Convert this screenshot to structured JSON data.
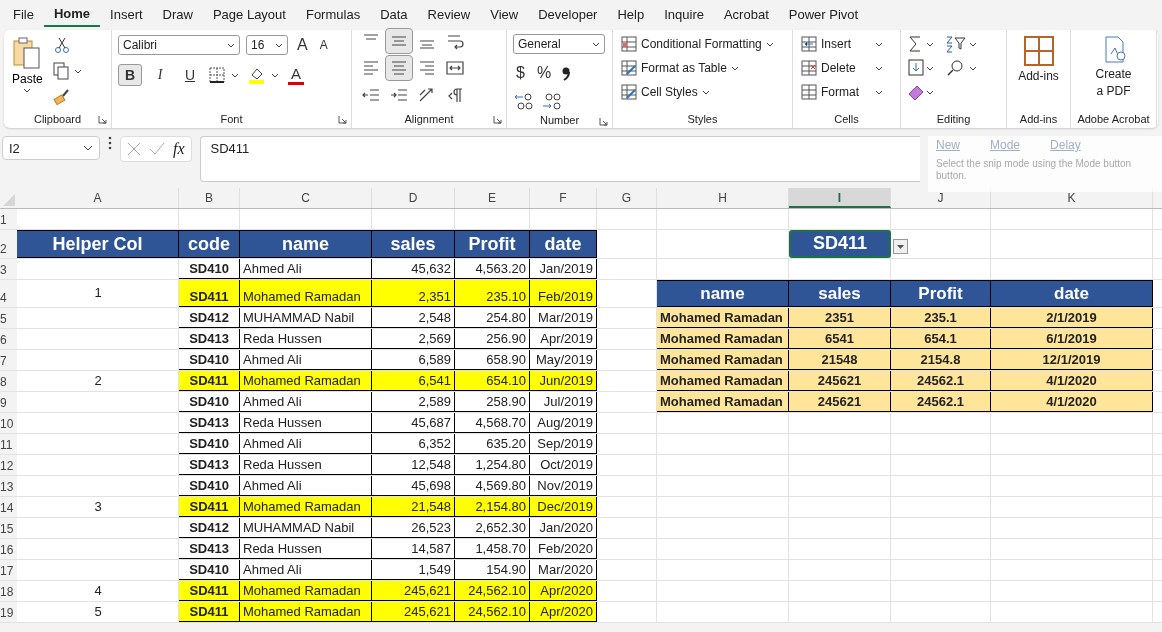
{
  "menu_tabs": [
    {
      "label": "File",
      "selected": false
    },
    {
      "label": "Home",
      "selected": true
    },
    {
      "label": "Insert",
      "selected": false
    },
    {
      "label": "Draw",
      "selected": false
    },
    {
      "label": "Page Layout",
      "selected": false
    },
    {
      "label": "Formulas",
      "selected": false
    },
    {
      "label": "Data",
      "selected": false
    },
    {
      "label": "Review",
      "selected": false
    },
    {
      "label": "View",
      "selected": false
    },
    {
      "label": "Developer",
      "selected": false
    },
    {
      "label": "Help",
      "selected": false
    },
    {
      "label": "Inquire",
      "selected": false
    },
    {
      "label": "Acrobat",
      "selected": false
    },
    {
      "label": "Power Pivot",
      "selected": false
    }
  ],
  "ribbon": {
    "clipboard": {
      "paste": "Paste",
      "label": "Clipboard"
    },
    "font": {
      "name": "Calibri",
      "size": "16",
      "grow": "A",
      "shrink": "A",
      "bold": {
        "label": "B",
        "selected": true
      },
      "italic": {
        "label": "I",
        "selected": false
      },
      "underline": {
        "label": "U",
        "selected": false
      },
      "font_color": "A",
      "label": "Font"
    },
    "alignment": {
      "rows": [
        [
          {
            "kind": "top",
            "selected": false
          },
          {
            "kind": "middle",
            "selected": true
          },
          {
            "kind": "bottom",
            "selected": false
          },
          {
            "kind": "wrap",
            "selected": false
          }
        ],
        [
          {
            "kind": "left",
            "selected": false
          },
          {
            "kind": "center",
            "selected": true
          },
          {
            "kind": "right",
            "selected": false
          },
          {
            "kind": "merge",
            "selected": false
          }
        ],
        [
          {
            "kind": "outdent",
            "selected": false
          },
          {
            "kind": "indent",
            "selected": false
          },
          {
            "kind": "orientation",
            "selected": false
          },
          {
            "kind": "rtl",
            "selected": false
          }
        ]
      ],
      "label": "Alignment"
    },
    "number": {
      "format": "General",
      "currency": "$",
      "percent": "%",
      "label": "Number"
    },
    "styles": {
      "items": [
        "Conditional Formatting",
        "Format as Table",
        "Cell Styles"
      ],
      "label": "Styles"
    },
    "cells": {
      "items": [
        "Insert",
        "Delete",
        "Format"
      ],
      "label": "Cells"
    },
    "editing": {
      "label": "Editing"
    },
    "addins": {
      "button": "Add-ins",
      "label": "Add-ins"
    },
    "acrobat": {
      "button_lines": [
        "Create",
        "a PDF"
      ],
      "label": "Adobe Acrobat"
    }
  },
  "formula_bar": {
    "name_box": "I2",
    "fx": "fx",
    "value": "SD411"
  },
  "snip_tool": {
    "buttons": [
      "New",
      "Mode",
      "Delay"
    ],
    "hint_lines": [
      "Select the snip mode using the Mode button",
      "button."
    ]
  },
  "sheet": {
    "column_letters": [
      {
        "label": "A",
        "selected": false
      },
      {
        "label": "B",
        "selected": false
      },
      {
        "label": "C",
        "selected": false
      },
      {
        "label": "D",
        "selected": false
      },
      {
        "label": "E",
        "selected": false
      },
      {
        "label": "F",
        "selected": false
      },
      {
        "label": "G",
        "selected": false
      },
      {
        "label": "H",
        "selected": false
      },
      {
        "label": "I",
        "selected": true
      },
      {
        "label": "J",
        "selected": false
      },
      {
        "label": "K",
        "selected": false
      }
    ],
    "row_numbers": [
      "1",
      "2",
      "3",
      "4",
      "5",
      "6",
      "7",
      "8",
      "9",
      "10",
      "11",
      "12",
      "13",
      "14",
      "15",
      "16",
      "17",
      "18",
      "19"
    ]
  },
  "main_table": {
    "columns": [
      "Helper Col",
      "code",
      "name",
      "sales",
      "Profit",
      "date"
    ],
    "rows": [
      {
        "code": "SD410",
        "name": "Ahmed Ali",
        "sales": "45,632",
        "profit": "4,563.20",
        "date": "Jan/2019",
        "highlighted": false
      },
      {
        "helper": "1",
        "code": "SD411",
        "name": "Mohamed Ramadan",
        "sales": "2,351",
        "profit": "235.10",
        "date": "Feb/2019",
        "highlighted": true
      },
      {
        "code": "SD412",
        "name": "MUHAMMAD Nabil",
        "sales": "2,548",
        "profit": "254.80",
        "date": "Mar/2019",
        "highlighted": false
      },
      {
        "code": "SD413",
        "name": "Reda Hussen",
        "sales": "2,569",
        "profit": "256.90",
        "date": "Apr/2019",
        "highlighted": false
      },
      {
        "code": "SD410",
        "name": "Ahmed Ali",
        "sales": "6,589",
        "profit": "658.90",
        "date": "May/2019",
        "highlighted": false
      },
      {
        "helper": "2",
        "code": "SD411",
        "name": "Mohamed Ramadan",
        "sales": "6,541",
        "profit": "654.10",
        "date": "Jun/2019",
        "highlighted": true
      },
      {
        "code": "SD410",
        "name": "Ahmed Ali",
        "sales": "2,589",
        "profit": "258.90",
        "date": "Jul/2019",
        "highlighted": false
      },
      {
        "code": "SD413",
        "name": "Reda Hussen",
        "sales": "45,687",
        "profit": "4,568.70",
        "date": "Aug/2019",
        "highlighted": false
      },
      {
        "code": "SD410",
        "name": "Ahmed Ali",
        "sales": "6,352",
        "profit": "635.20",
        "date": "Sep/2019",
        "highlighted": false
      },
      {
        "code": "SD413",
        "name": "Reda Hussen",
        "sales": "12,548",
        "profit": "1,254.80",
        "date": "Oct/2019",
        "highlighted": false
      },
      {
        "code": "SD410",
        "name": "Ahmed Ali",
        "sales": "45,698",
        "profit": "4,569.80",
        "date": "Nov/2019",
        "highlighted": false
      },
      {
        "helper": "3",
        "code": "SD411",
        "name": "Mohamed Ramadan",
        "sales": "21,548",
        "profit": "2,154.80",
        "date": "Dec/2019",
        "highlighted": true
      },
      {
        "code": "SD412",
        "name": "MUHAMMAD Nabil",
        "sales": "26,523",
        "profit": "2,652.30",
        "date": "Jan/2020",
        "highlighted": false
      },
      {
        "code": "SD413",
        "name": "Reda Hussen",
        "sales": "14,587",
        "profit": "1,458.70",
        "date": "Feb/2020",
        "highlighted": false
      },
      {
        "code": "SD410",
        "name": "Ahmed Ali",
        "sales": "1,549",
        "profit": "154.90",
        "date": "Mar/2020",
        "highlighted": false
      },
      {
        "helper": "4",
        "code": "SD411",
        "name": "Mohamed Ramadan",
        "sales": "245,621",
        "profit": "24,562.10",
        "date": "Apr/2020",
        "highlighted": true
      },
      {
        "helper": "5",
        "code": "SD411",
        "name": "Mohamed Ramadan",
        "sales": "245,621",
        "profit": "24,562.10",
        "date": "Apr/2020",
        "highlighted": true
      }
    ]
  },
  "lookup_cell": {
    "value": "SD411",
    "selected": true
  },
  "result_table": {
    "columns": [
      "name",
      "sales",
      "Profit",
      "date"
    ],
    "rows": [
      {
        "name": "Mohamed Ramadan",
        "sales": "2351",
        "profit": "235.1",
        "date": "2/1/2019"
      },
      {
        "name": "Mohamed Ramadan",
        "sales": "6541",
        "profit": "654.1",
        "date": "6/1/2019"
      },
      {
        "name": "Mohamed Ramadan",
        "sales": "21548",
        "profit": "2154.8",
        "date": "12/1/2019"
      },
      {
        "name": "Mohamed Ramadan",
        "sales": "245621",
        "profit": "24562.1",
        "date": "4/1/2020"
      },
      {
        "name": "Mohamed Ramadan",
        "sales": "245621",
        "profit": "24562.1",
        "date": "4/1/2020"
      }
    ]
  }
}
